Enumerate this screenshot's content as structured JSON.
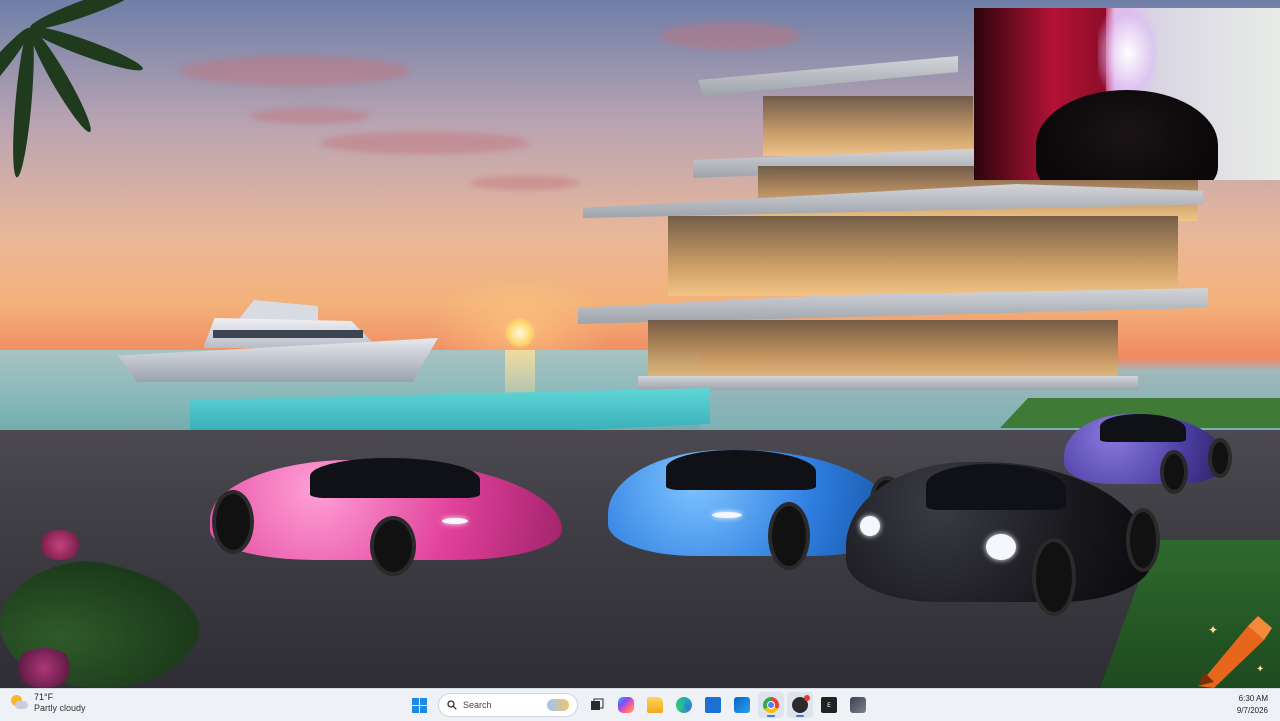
{
  "wallpaper": {
    "description_icon": "beach-mansion-wallpaper"
  },
  "webcam": {
    "icon": "webcam-feed"
  },
  "taskbar": {
    "weather": {
      "icon": "partly-cloudy-icon",
      "temperature": "71°F",
      "condition": "Partly cloudy"
    },
    "search": {
      "placeholder": "Search"
    },
    "apps": [
      {
        "name": "start",
        "icon": "windows-logo-icon"
      },
      {
        "name": "search",
        "icon": "search-icon"
      },
      {
        "name": "task-view",
        "icon": "task-view-icon"
      },
      {
        "name": "copilot",
        "icon": "copilot-icon"
      },
      {
        "name": "file-explorer",
        "icon": "folder-icon"
      },
      {
        "name": "edge",
        "icon": "edge-icon"
      },
      {
        "name": "microsoft-store",
        "icon": "store-icon"
      },
      {
        "name": "outlook",
        "icon": "outlook-icon"
      },
      {
        "name": "chrome",
        "icon": "chrome-icon"
      },
      {
        "name": "obs",
        "icon": "obs-icon"
      },
      {
        "name": "epic-games",
        "icon": "epic-games-icon"
      },
      {
        "name": "app-settings",
        "icon": "app-icon"
      }
    ],
    "clock": {
      "time": "6:30 AM",
      "date": "9/7/2026"
    },
    "colors": {
      "taskbar_bg": "#eef1f6",
      "accent": "#3b7ad6"
    }
  }
}
